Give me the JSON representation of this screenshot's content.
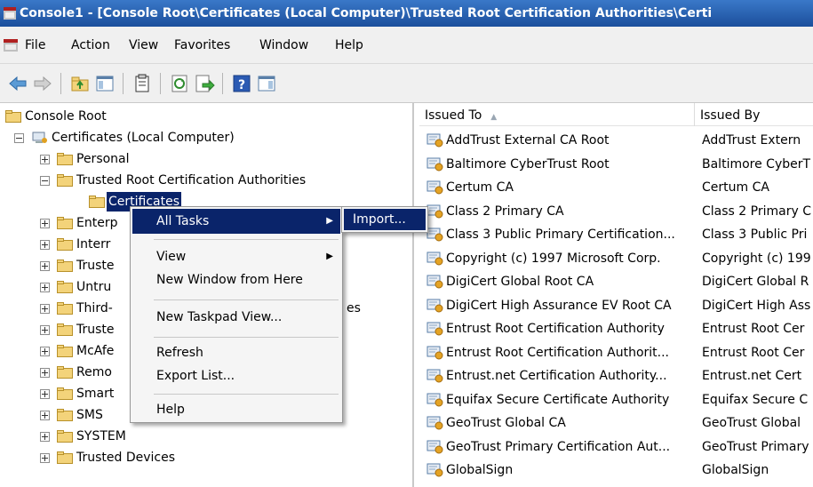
{
  "window": {
    "title": "Console1 - [Console Root\\Certificates (Local Computer)\\Trusted Root Certification Authorities\\Certi"
  },
  "menubar": {
    "items": [
      "File",
      "Action",
      "View",
      "Favorites",
      "Window",
      "Help"
    ]
  },
  "toolbar": {
    "icons": [
      "back-icon",
      "forward-icon",
      "up-folder-icon",
      "show-hide-tree-icon",
      "properties-icon",
      "refresh-icon",
      "export-list-icon",
      "help-icon",
      "show-hide-action-pane-icon"
    ]
  },
  "tree": {
    "root": "Console Root",
    "computer": "Certificates (Local Computer)",
    "personal": "Personal",
    "trusted_root": "Trusted Root Certification Authorities",
    "certificates": "Certificates",
    "items": [
      "Enterp",
      "Interr",
      "Truste",
      "Untru",
      "Third-",
      "Truste",
      "McAfe",
      "Remo",
      "Smart",
      "SMS",
      "SYSTEM",
      "Trusted Devices"
    ],
    "third_party_suffix": "es"
  },
  "list": {
    "columns": [
      "Issued To",
      "Issued By"
    ],
    "rows": [
      {
        "issued_to": "AddTrust External CA Root",
        "issued_by": "AddTrust Extern"
      },
      {
        "issued_to": "Baltimore CyberTrust Root",
        "issued_by": "Baltimore CyberT"
      },
      {
        "issued_to": "Certum CA",
        "issued_by": "Certum CA"
      },
      {
        "issued_to": "Class 2 Primary CA",
        "issued_by": "Class 2 Primary C"
      },
      {
        "issued_to": "Class 3 Public Primary Certification...",
        "issued_by": "Class 3 Public Pri"
      },
      {
        "issued_to": "Copyright (c) 1997 Microsoft Corp.",
        "issued_by": "Copyright (c) 199"
      },
      {
        "issued_to": "DigiCert Global Root CA",
        "issued_by": "DigiCert Global R"
      },
      {
        "issued_to": "DigiCert High Assurance EV Root CA",
        "issued_by": "DigiCert High Ass"
      },
      {
        "issued_to": "Entrust Root Certification Authority",
        "issued_by": "Entrust Root Cer"
      },
      {
        "issued_to": "Entrust Root Certification Authorit...",
        "issued_by": "Entrust Root Cer"
      },
      {
        "issued_to": "Entrust.net Certification Authority...",
        "issued_by": "Entrust.net Cert"
      },
      {
        "issued_to": "Equifax Secure Certificate Authority",
        "issued_by": "Equifax Secure C"
      },
      {
        "issued_to": "GeoTrust Global CA",
        "issued_by": "GeoTrust Global"
      },
      {
        "issued_to": "GeoTrust Primary Certification Aut...",
        "issued_by": "GeoTrust Primary"
      },
      {
        "issued_to": "GlobalSign",
        "issued_by": "GlobalSign"
      }
    ]
  },
  "context_menu": {
    "all_tasks": "All Tasks",
    "view": "View",
    "new_window": "New Window from Here",
    "new_taskpad": "New Taskpad View...",
    "refresh": "Refresh",
    "export_list": "Export List...",
    "help": "Help"
  },
  "submenu": {
    "import": "Import..."
  },
  "colors": {
    "titlebar": "#1c4f9c",
    "selection": "#0a246a",
    "menu_bg": "#f5f5f5"
  }
}
